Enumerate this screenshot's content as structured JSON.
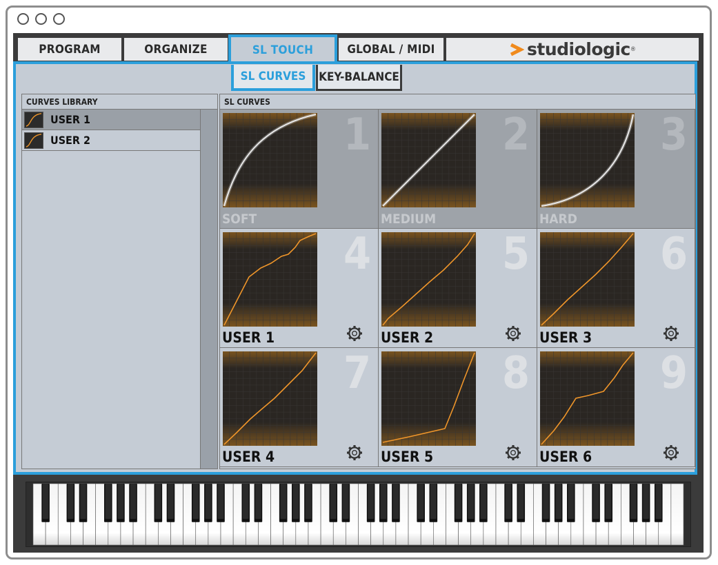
{
  "tabs": [
    {
      "label": "PROGRAM",
      "active": false
    },
    {
      "label": "ORGANIZE",
      "active": false
    },
    {
      "label": "SL TOUCH",
      "active": true
    },
    {
      "label": "GLOBAL / MIDI",
      "active": false
    }
  ],
  "logo": {
    "text": "studiologic",
    "reg": "®",
    "accent_color": "#f08a1c"
  },
  "subtabs": [
    {
      "label": "SL CURVES",
      "active": true
    },
    {
      "label": "KEY-BALANCE",
      "active": false
    }
  ],
  "library": {
    "title": "CURVES LIBRARY",
    "items": [
      {
        "label": "USER 1",
        "selected": true
      },
      {
        "label": "USER 2",
        "selected": false
      }
    ]
  },
  "curves": {
    "title": "SL CURVES",
    "cells": [
      {
        "num": "1",
        "label": "SOFT",
        "kind": "preset"
      },
      {
        "num": "2",
        "label": "MEDIUM",
        "kind": "preset"
      },
      {
        "num": "3",
        "label": "HARD",
        "kind": "preset"
      },
      {
        "num": "4",
        "label": "USER 1",
        "kind": "user"
      },
      {
        "num": "5",
        "label": "USER 2",
        "kind": "user"
      },
      {
        "num": "6",
        "label": "USER 3",
        "kind": "user"
      },
      {
        "num": "7",
        "label": "USER 4",
        "kind": "user"
      },
      {
        "num": "8",
        "label": "USER 5",
        "kind": "user"
      },
      {
        "num": "9",
        "label": "USER 6",
        "kind": "user"
      }
    ]
  },
  "colors": {
    "accent_blue": "#2c9fdb",
    "curve_orange": "#f0962a",
    "curve_white": "#e8e8e8"
  }
}
